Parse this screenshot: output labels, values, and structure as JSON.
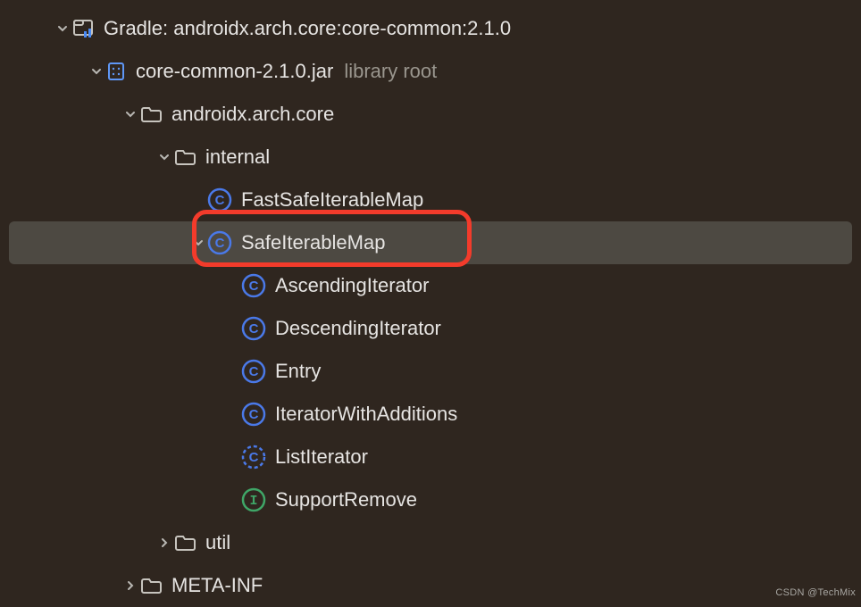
{
  "tree": {
    "root": {
      "label": "Gradle: androidx.arch.core:core-common:2.1.0",
      "expanded": true,
      "type": "library"
    },
    "jar": {
      "label": "core-common-2.1.0.jar",
      "suffix": "library root",
      "expanded": true,
      "type": "jar"
    },
    "pkg": {
      "label": "androidx.arch.core",
      "expanded": true,
      "type": "folder"
    },
    "internal": {
      "label": "internal",
      "expanded": true,
      "type": "folder"
    },
    "classes": [
      {
        "label": "FastSafeIterableMap",
        "icon": "class",
        "selected": false,
        "hasChildren": false
      },
      {
        "label": "SafeIterableMap",
        "icon": "class",
        "selected": true,
        "hasChildren": true,
        "expanded": true
      },
      {
        "label": "AscendingIterator",
        "icon": "class",
        "selected": false,
        "hasChildren": false
      },
      {
        "label": "DescendingIterator",
        "icon": "class",
        "selected": false,
        "hasChildren": false
      },
      {
        "label": "Entry",
        "icon": "class",
        "selected": false,
        "hasChildren": false
      },
      {
        "label": "IteratorWithAdditions",
        "icon": "class",
        "selected": false,
        "hasChildren": false
      },
      {
        "label": "ListIterator",
        "icon": "abstract-class",
        "selected": false,
        "hasChildren": false
      },
      {
        "label": "SupportRemove",
        "icon": "interface",
        "selected": false,
        "hasChildren": false
      }
    ],
    "util": {
      "label": "util",
      "expanded": false,
      "type": "folder"
    },
    "meta": {
      "label": "META-INF",
      "expanded": false,
      "type": "folder"
    }
  },
  "highlight_target": "SafeIterableMap",
  "watermark": "CSDN @TechMix"
}
